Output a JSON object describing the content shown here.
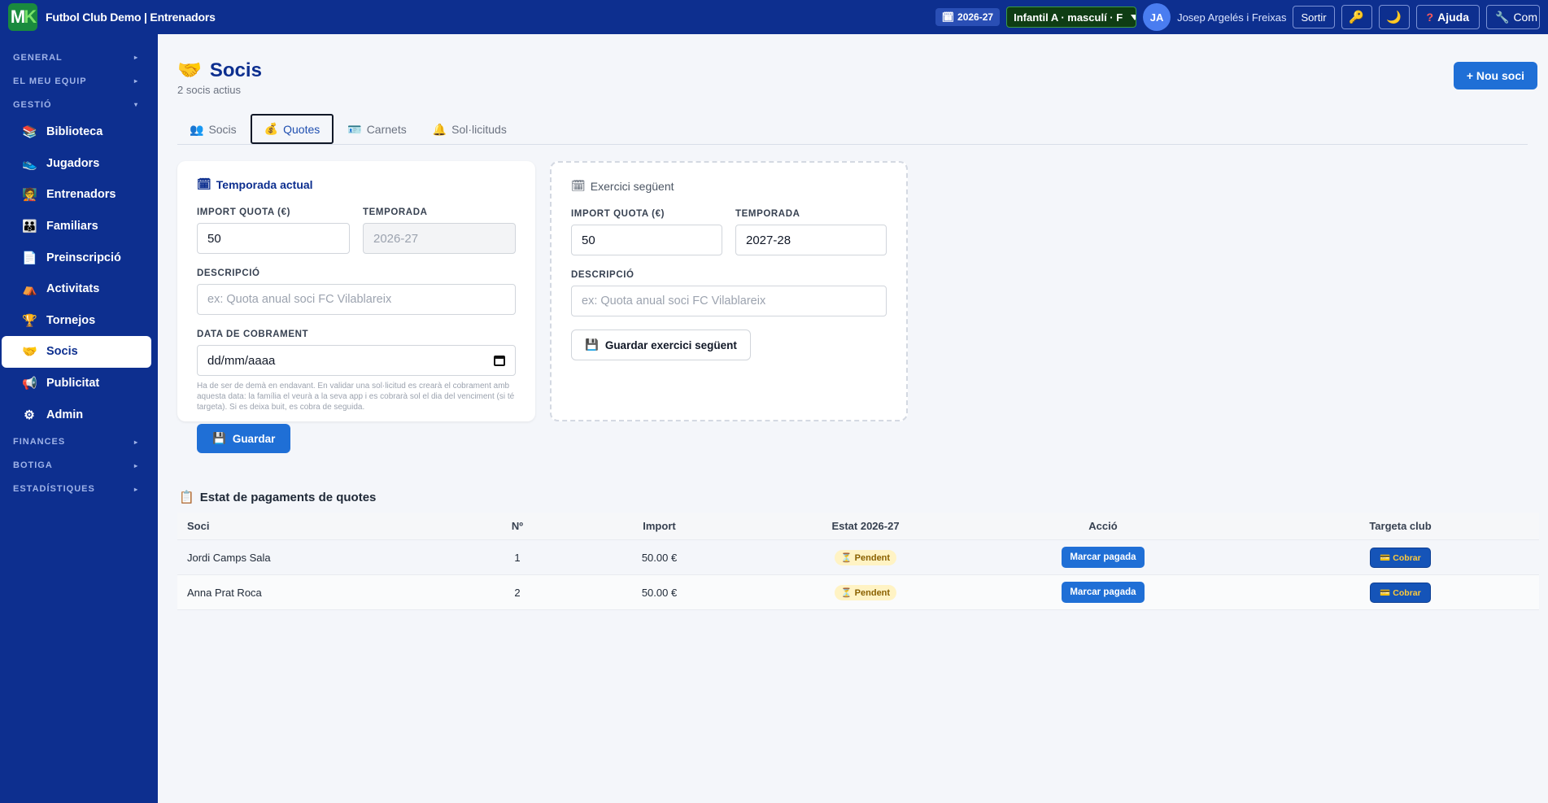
{
  "topbar": {
    "logo_m": "M",
    "logo_k": "K",
    "title": "Futbol Club Demo | Entrenadors",
    "season": "2026-27",
    "team": "Infantil A · masculí · F",
    "avatar": "JA",
    "user": "Josep Argelés i Freixas",
    "logout": "Sortir",
    "help": "Ajuda",
    "com": "Com"
  },
  "sidebar": {
    "sections": {
      "general": "GENERAL",
      "team": "EL MEU EQUIP",
      "gestio": "GESTIÓ",
      "finances": "FINANCES",
      "botiga": "BOTIGA",
      "stats": "ESTADÍSTIQUES"
    },
    "items": [
      {
        "label": "Biblioteca",
        "icon": "books-icon"
      },
      {
        "label": "Jugadors",
        "icon": "boot-icon"
      },
      {
        "label": "Entrenadors",
        "icon": "coach-icon"
      },
      {
        "label": "Familiars",
        "icon": "family-icon"
      },
      {
        "label": "Preinscripció",
        "icon": "document-icon"
      },
      {
        "label": "Activitats",
        "icon": "tent-icon"
      },
      {
        "label": "Tornejos",
        "icon": "trophy-icon"
      },
      {
        "label": "Socis",
        "icon": "handshake-icon"
      },
      {
        "label": "Publicitat",
        "icon": "megaphone-icon"
      },
      {
        "label": "Admin",
        "icon": "gear-icon"
      }
    ]
  },
  "page": {
    "title": "Socis",
    "subtitle": "2 socis actius",
    "new_button": "+ Nou soci"
  },
  "tabs": [
    {
      "label": "Socis"
    },
    {
      "label": "Quotes"
    },
    {
      "label": "Carnets"
    },
    {
      "label": "Sol·licituds"
    }
  ],
  "current": {
    "title": "Temporada actual",
    "fee_label": "IMPORT QUOTA (€)",
    "fee_value": "50",
    "season_label": "TEMPORADA",
    "season_value": "2026-27",
    "desc_label": "DESCRIPCIÓ",
    "desc_placeholder": "ex: Quota anual soci FC Vilablareix",
    "date_label": "DATA DE COBRAMENT",
    "date_placeholder": "dd/mm/aaaa",
    "hint": "Ha de ser de demà en endavant. En validar una sol·licitud es crearà el cobrament amb aquesta data: la família el veurà a la seva app i es cobrarà sol el dia del venciment (si té targeta). Si es deixa buit, es cobra de seguida.",
    "save": "Guardar"
  },
  "next": {
    "title": "Exercici següent",
    "fee_label": "IMPORT QUOTA (€)",
    "fee_value": "50",
    "season_label": "TEMPORADA",
    "season_value": "2027-28",
    "desc_label": "DESCRIPCIÓ",
    "desc_placeholder": "ex: Quota anual soci FC Vilablareix",
    "save": "Guardar exercici següent"
  },
  "payments": {
    "title": "Estat de pagaments de quotes",
    "headers": [
      "Soci",
      "Nº",
      "Import",
      "Estat 2026-27",
      "Acció",
      "Targeta club"
    ],
    "rows": [
      {
        "name": "Jordi Camps Sala",
        "num": "1",
        "amount": "50.00 €",
        "status": "Pendent",
        "action": "Marcar pagada",
        "card": "Cobrar"
      },
      {
        "name": "Anna Prat Roca",
        "num": "2",
        "amount": "50.00 €",
        "status": "Pendent",
        "action": "Marcar pagada",
        "card": "Cobrar"
      }
    ]
  }
}
